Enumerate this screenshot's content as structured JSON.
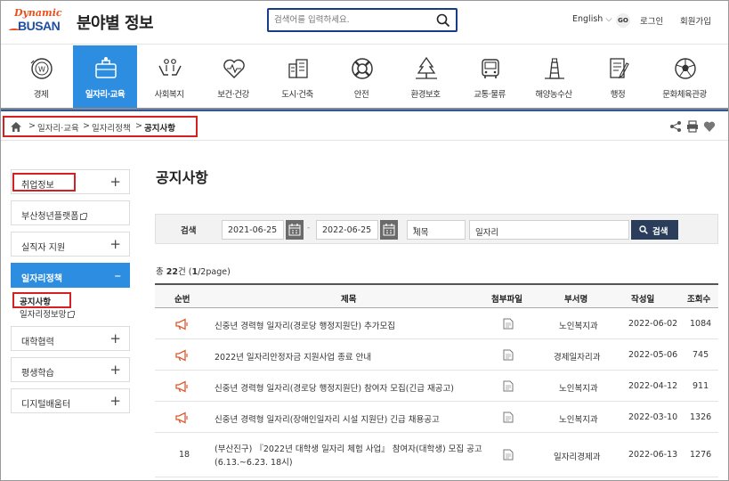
{
  "header": {
    "logo_top": "Dynamic",
    "logo_bottom": "BUSAN",
    "title": "분야별 정보",
    "search_placeholder": "검색어를 입력하세요.",
    "language": "English",
    "go": "GO",
    "login": "로그인",
    "join": "회원가입"
  },
  "gnb": [
    {
      "label": "경제",
      "icon": "won-coin-icon"
    },
    {
      "label": "일자리·교육",
      "icon": "briefcase-icon",
      "active": true
    },
    {
      "label": "사회복지",
      "icon": "hands-people-icon"
    },
    {
      "label": "보건·건강",
      "icon": "heart-health-icon"
    },
    {
      "label": "도시·건축",
      "icon": "buildings-icon"
    },
    {
      "label": "안전",
      "icon": "lifebuoy-icon"
    },
    {
      "label": "환경보호",
      "icon": "trees-icon"
    },
    {
      "label": "교통·물류",
      "icon": "bus-icon"
    },
    {
      "label": "해양농수산",
      "icon": "lighthouse-icon"
    },
    {
      "label": "행정",
      "icon": "document-pen-icon"
    },
    {
      "label": "문화체육관광",
      "icon": "soccer-ball-icon"
    }
  ],
  "breadcrumb": {
    "items": [
      "일자리·교육",
      "일자리정책",
      "공지사항"
    ]
  },
  "sidebar": {
    "menu": [
      {
        "label": "취업정보",
        "toggle": "+"
      },
      {
        "label": "부산청년플랫폼",
        "toggle": ""
      },
      {
        "label": "실직자 지원",
        "toggle": "+"
      },
      {
        "label": "일자리정책",
        "toggle": "–",
        "active": true
      },
      {
        "label": "대학협력",
        "toggle": "+"
      },
      {
        "label": "평생학습",
        "toggle": "+"
      },
      {
        "label": "디지털배움터",
        "toggle": "+"
      }
    ],
    "sub": [
      "공지사항",
      "일자리정보망"
    ]
  },
  "main": {
    "title": "공지사항",
    "search": {
      "label": "검색",
      "date_from": "2021-06-25",
      "date_sep": "-",
      "date_to": "2022-06-25",
      "field": "제목",
      "keyword": "일자리",
      "button": "검색"
    },
    "total": {
      "prefix": "총 ",
      "count": "22",
      "suffix": "건 (",
      "page": "1",
      "page_total": "/2page)"
    },
    "columns": [
      "순번",
      "제목",
      "첨부파일",
      "부서명",
      "작성일",
      "조회수"
    ],
    "rows": [
      {
        "no": "",
        "notice": true,
        "title": "신중년 경력형 일자리(경로당 행정지원단) 추가모집",
        "title2": "",
        "dept": "노인복지과",
        "date": "2022-06-02",
        "views": "1084"
      },
      {
        "no": "",
        "notice": true,
        "title": "2022년 일자리안정자금 지원사업 종료 안내",
        "title2": "",
        "dept": "경제일자리과",
        "date": "2022-05-06",
        "views": "745"
      },
      {
        "no": "",
        "notice": true,
        "title": "신중년 경력형 일자리(경로당 행정지원단) 참여자 모집(긴급 재공고)",
        "title2": "",
        "dept": "노인복지과",
        "date": "2022-04-12",
        "views": "911"
      },
      {
        "no": "",
        "notice": true,
        "title": "신중년 경력형 일자리(장애인일자리 시설 지원단) 긴급 채용공고",
        "title2": "",
        "dept": "노인복지과",
        "date": "2022-03-10",
        "views": "1326"
      },
      {
        "no": "18",
        "notice": false,
        "title": "(부산진구) 『2022년 대학생 일자리 체험 사업』 참여자(대학생) 모집 공고",
        "title2": "(6.13.~6.23. 18시)",
        "dept": "일자리경제과",
        "date": "2022-06-13",
        "views": "1276"
      }
    ]
  }
}
